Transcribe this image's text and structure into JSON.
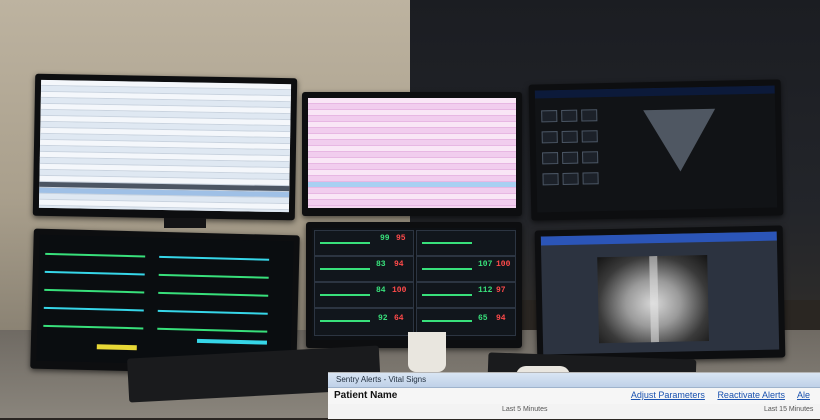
{
  "popup": {
    "title": "Sentry Alerts - Vital Signs",
    "patient_label": "Patient Name",
    "links": [
      "Adjust Parameters",
      "Reactivate Alerts",
      "Ale"
    ],
    "sub_headers": [
      "Last 5 Minutes",
      "Last 15 Minutes"
    ]
  },
  "colors": {
    "wall": "#bdb3a0",
    "pink_screen": "#f4d6f0",
    "xray_bar": "#2b55b8",
    "trace_green": "#38e07b",
    "trace_cyan": "#36d6e8",
    "trace_yellow": "#e8d836",
    "number_red": "#ff4a4a"
  },
  "vitals_numbers": [
    "99",
    "95",
    "83",
    "94",
    "107",
    "100",
    "84",
    "100",
    "112",
    "97",
    "92",
    "64",
    "65",
    "94"
  ]
}
